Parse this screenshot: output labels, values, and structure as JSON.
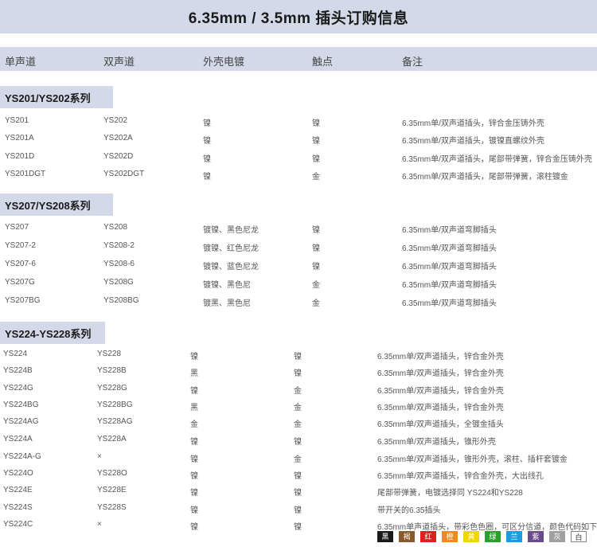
{
  "title": "6.35mm / 3.5mm 插头订购信息",
  "headers": [
    "单声道",
    "双声道",
    "外壳电镀",
    "触点",
    "备注"
  ],
  "sections": [
    {
      "name": "YS201/YS202系列",
      "rows": [
        [
          "YS201",
          "YS202",
          "镍",
          "镍",
          "6.35mm单/双声道插头，锌合金压铸外壳"
        ],
        [
          "YS201A",
          "YS202A",
          "镍",
          "镍",
          "6.35mm单/双声道插头，镀镍直螺纹外壳"
        ],
        [
          "YS201D",
          "YS202D",
          "镍",
          "镍",
          "6.35mm单/双声道插头，尾部带弹簧，锌合金压铸外壳"
        ],
        [
          "YS201DGT",
          "YS202DGT",
          "镍",
          "金",
          "6.35mm单/双声道插头，尾部带弹簧，滚柱镀金"
        ]
      ]
    },
    {
      "name": "YS207/YS208系列",
      "rows": [
        [
          "YS207",
          "YS208",
          "镀镍、黑色尼龙",
          "镍",
          "6.35mm单/双声道弯脚插头"
        ],
        [
          "YS207-2",
          "YS208-2",
          "镀镍、红色尼龙",
          "镍",
          "6.35mm单/双声道弯脚插头"
        ],
        [
          "YS207-6",
          "YS208-6",
          "镀镍、蓝色尼龙",
          "镍",
          "6.35mm单/双声道弯脚插头"
        ],
        [
          "YS207G",
          "YS208G",
          "镀镍、黑色尼",
          "金",
          "6.35mm单/双声道弯脚插头"
        ],
        [
          "YS207BG",
          "YS208BG",
          "镀黑、黑色尼",
          "金",
          "6.35mm单/双声道弯脚插头"
        ]
      ]
    },
    {
      "name": "YS224-YS228系列",
      "rows": [
        [
          "YS224",
          "YS228",
          "镍",
          "镍",
          "6.35mm单/双声道插头，锌合金外壳"
        ],
        [
          "YS224B",
          "YS228B",
          "黑",
          "镍",
          "6.35mm单/双声道插头，锌合金外壳"
        ],
        [
          "YS224G",
          "YS228G",
          "镍",
          "金",
          "6.35mm单/双声道插头，锌合金外壳"
        ],
        [
          "YS224BG",
          "YS228BG",
          "黑",
          "金",
          "6.35mm单/双声道插头，锌合金外壳"
        ],
        [
          "YS224AG",
          "YS228AG",
          "金",
          "金",
          "6.35mm单/双声道插头，全镀金插头"
        ],
        [
          "YS224A",
          "YS228A",
          "镍",
          "镍",
          "6.35mm单/双声道插头，锥形外壳"
        ],
        [
          "YS224A-G",
          "×",
          "镍",
          "金",
          "6.35mm单/双声道插头，锥形外壳，滚柱、插杆套镀金"
        ],
        [
          "YS224O",
          "YS228O",
          "镍",
          "镍",
          "6.35mm单/双声道插头，锌合金外壳，大出线孔"
        ],
        [
          "YS224E",
          "YS228E",
          "镍",
          "镍",
          "尾部带弹簧，电镀选择同 YS224和YS228"
        ],
        [
          "YS224S",
          "YS228S",
          "镍",
          "镍",
          "带开关的6.35插头"
        ],
        [
          "YS224C",
          "×",
          "镍",
          "镍",
          "6.35mm单声道插头，带彩色色圈，可区分信道，颜色代码如下："
        ]
      ]
    }
  ],
  "color_codes": [
    {
      "label": "黑",
      "color": "#1a1a1a"
    },
    {
      "label": "褐",
      "color": "#8b5a2b"
    },
    {
      "label": "红",
      "color": "#e02020"
    },
    {
      "label": "橙",
      "color": "#f08a1c"
    },
    {
      "label": "黄",
      "color": "#f2d600"
    },
    {
      "label": "绿",
      "color": "#2aa02a"
    },
    {
      "label": "兰",
      "color": "#1e9be0"
    },
    {
      "label": "紫",
      "color": "#6a4a8a"
    },
    {
      "label": "灰",
      "color": "#a0a0a0"
    },
    {
      "label": "白",
      "color": "#ffffff"
    }
  ]
}
